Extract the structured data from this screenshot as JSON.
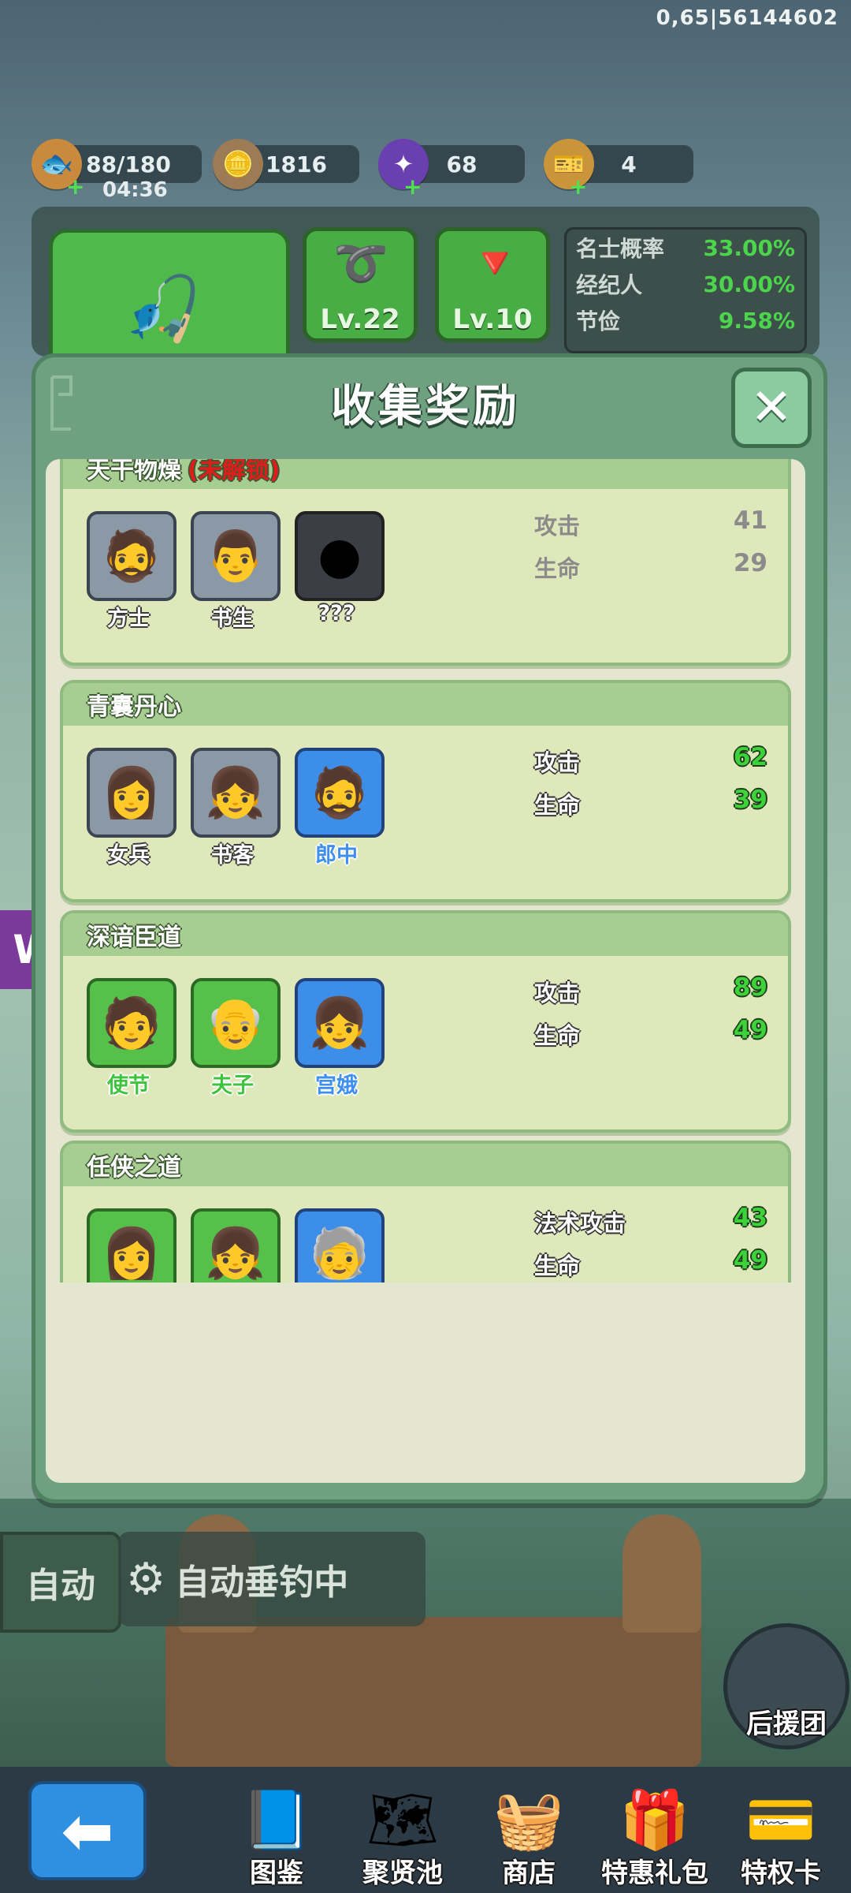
{
  "debug_id": "0,65|56144602",
  "resources": {
    "stamina": "88/180",
    "stamina_timer": "04:36",
    "coins": "1816",
    "gems": "68",
    "tokens": "4"
  },
  "equipment": {
    "rod_level": "Lv.22",
    "bait_level": "Lv.10"
  },
  "top_stats": [
    {
      "label": "名士概率",
      "value": "33.00%"
    },
    {
      "label": "经纪人",
      "value": "30.00%"
    },
    {
      "label": "节俭",
      "value": "9.58%"
    }
  ],
  "dialog": {
    "title": "收集奖励",
    "close_icon": "close-icon"
  },
  "cards": [
    {
      "title": "天干物燥",
      "lock": "(未解锁)",
      "heroes": [
        {
          "name": "方士",
          "icon": "hero-fangshi-icon",
          "tier": "gray"
        },
        {
          "name": "书生",
          "icon": "hero-shusheng-icon",
          "tier": "gray"
        },
        {
          "name": "???",
          "icon": "locked-hero-silhouette-icon",
          "tier": "dark"
        }
      ],
      "bonuses": [
        {
          "label": "攻击",
          "value": "41"
        },
        {
          "label": "生命",
          "value": "29"
        }
      ]
    },
    {
      "title": "青囊丹心",
      "heroes": [
        {
          "name": "女兵",
          "icon": "hero-nvbing-icon",
          "tier": "gray"
        },
        {
          "name": "书客",
          "icon": "hero-shuke-icon",
          "tier": "gray"
        },
        {
          "name": "郎中",
          "icon": "hero-langzhong-icon",
          "tier": "blue"
        }
      ],
      "bonuses": [
        {
          "label": "攻击",
          "value": "62"
        },
        {
          "label": "生命",
          "value": "39"
        }
      ]
    },
    {
      "title": "深谙臣道",
      "heroes": [
        {
          "name": "使节",
          "icon": "hero-shijie-icon",
          "tier": "green"
        },
        {
          "name": "夫子",
          "icon": "hero-fuzi-icon",
          "tier": "green"
        },
        {
          "name": "宫娥",
          "icon": "hero-gonge-icon",
          "tier": "blue"
        }
      ],
      "bonuses": [
        {
          "label": "攻击",
          "value": "89"
        },
        {
          "label": "生命",
          "value": "49"
        }
      ]
    },
    {
      "title": "任侠之道",
      "heroes": [
        {
          "name": "",
          "icon": "hero-female-warrior-icon",
          "tier": "green"
        },
        {
          "name": "",
          "icon": "hero-girl-icon",
          "tier": "green"
        },
        {
          "name": "",
          "icon": "hero-silver-hair-icon",
          "tier": "blue"
        }
      ],
      "bonuses": [
        {
          "label": "法术攻击",
          "value": "43"
        },
        {
          "label": "生命",
          "value": "49"
        }
      ]
    }
  ],
  "auto": {
    "button": "自动",
    "status": "自动垂钓中"
  },
  "support_label": "后援团",
  "nav": [
    {
      "label": "图鉴",
      "icon": "book-icon"
    },
    {
      "label": "聚贤池",
      "icon": "map-scroll-icon"
    },
    {
      "label": "商店",
      "icon": "shop-basket-icon"
    },
    {
      "label": "特惠礼包",
      "icon": "gift-pack-icon"
    },
    {
      "label": "特权卡",
      "icon": "privilege-card-icon"
    }
  ]
}
